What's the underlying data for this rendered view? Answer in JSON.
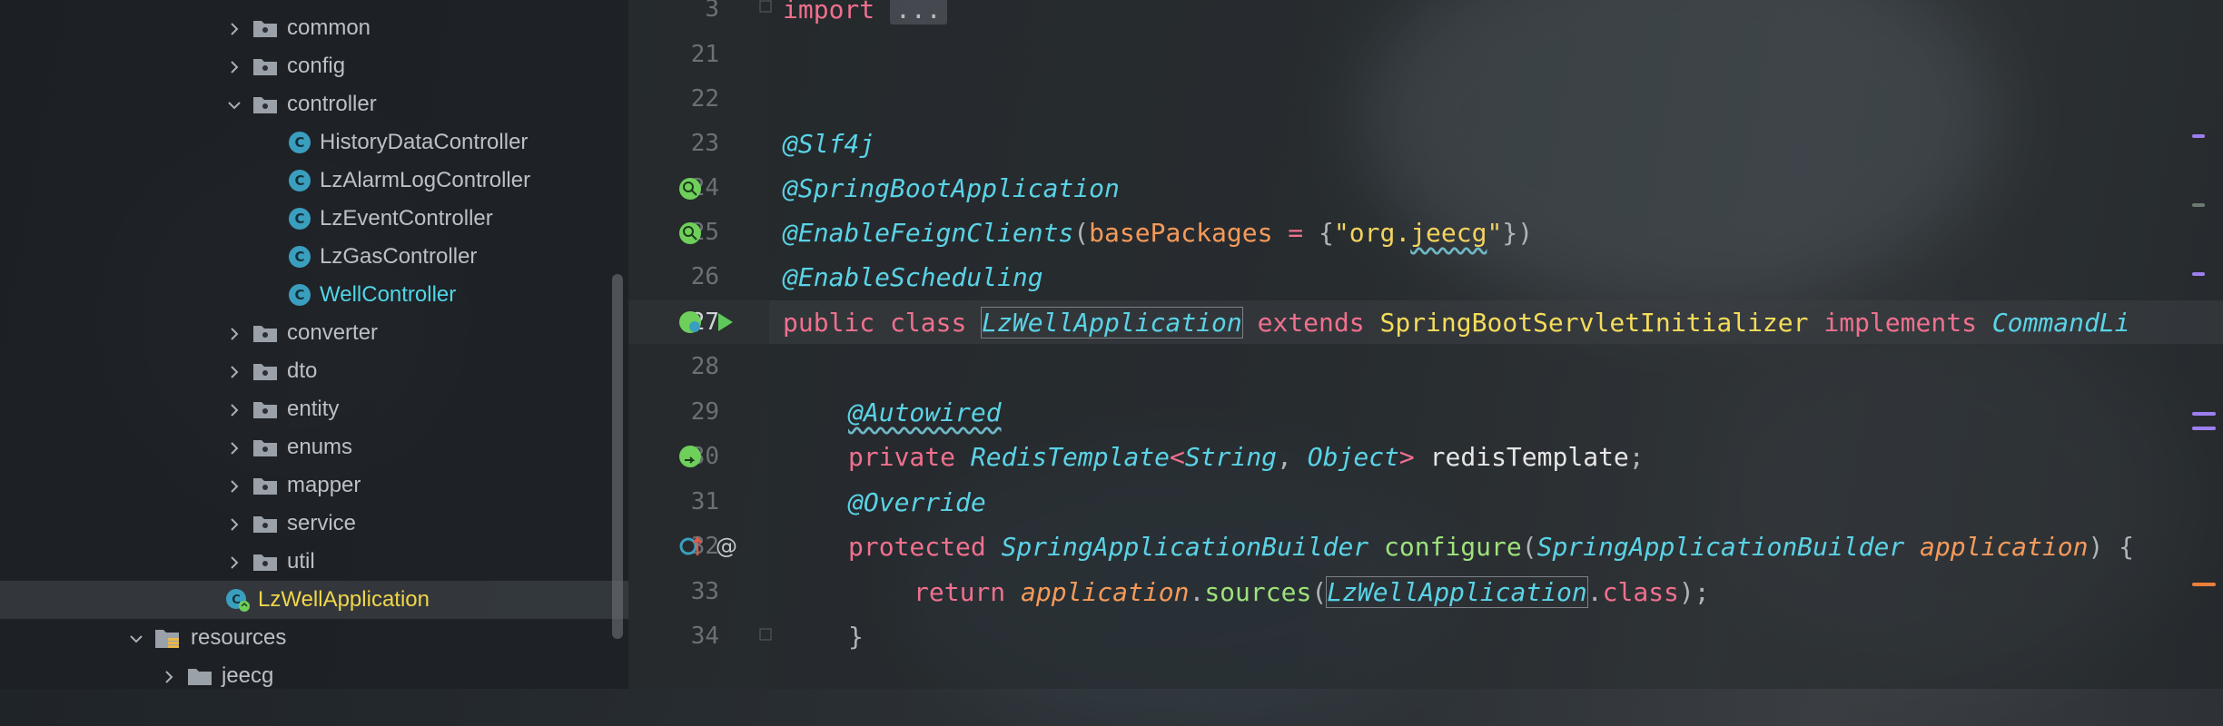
{
  "project_tree": {
    "items": [
      {
        "label": "common",
        "kind": "folder",
        "expanded": false
      },
      {
        "label": "config",
        "kind": "folder",
        "expanded": false
      },
      {
        "label": "controller",
        "kind": "folder",
        "expanded": true
      },
      {
        "label": "HistoryDataController",
        "kind": "class"
      },
      {
        "label": "LzAlarmLogController",
        "kind": "class"
      },
      {
        "label": "LzEventController",
        "kind": "class"
      },
      {
        "label": "LzGasController",
        "kind": "class"
      },
      {
        "label": "WellController",
        "kind": "class"
      },
      {
        "label": "converter",
        "kind": "folder",
        "expanded": false
      },
      {
        "label": "dto",
        "kind": "folder",
        "expanded": false
      },
      {
        "label": "entity",
        "kind": "folder",
        "expanded": false
      },
      {
        "label": "enums",
        "kind": "folder",
        "expanded": false
      },
      {
        "label": "mapper",
        "kind": "folder",
        "expanded": false
      },
      {
        "label": "service",
        "kind": "folder",
        "expanded": false
      },
      {
        "label": "util",
        "kind": "folder",
        "expanded": false
      },
      {
        "label": "LzWellApplication",
        "kind": "app-class"
      },
      {
        "label": "resources",
        "kind": "resources-folder",
        "expanded": true
      },
      {
        "label": "jeecg",
        "kind": "folder",
        "expanded": false
      }
    ]
  },
  "editor": {
    "line_numbers": [
      "3",
      "21",
      "22",
      "23",
      "24",
      "25",
      "26",
      "27",
      "28",
      "29",
      "30",
      "31",
      "32",
      "33",
      "34"
    ],
    "current_line": "27",
    "code": {
      "l3_import": "import",
      "l3_fold": "...",
      "l23": "@Slf4j",
      "l24": "@SpringBootApplication",
      "l25_ann": "@EnableFeignClients",
      "l25_paren_open": "(",
      "l25_param": "basePackages",
      "l25_eq": " = ",
      "l25_brace_open": "{",
      "l25_str_q1": "\"",
      "l25_str_a": "org.",
      "l25_str_b": "jeecg",
      "l25_str_q2": "\"",
      "l25_close": "})",
      "l26": "@EnableScheduling",
      "l27_public": "public",
      "l27_class": "class",
      "l27_name": "LzWellApplication",
      "l27_extends": "extends",
      "l27_parent": "SpringBootServletInitializer",
      "l27_implements": "implements",
      "l27_iface": "CommandLi",
      "l29": "@Autowired",
      "l30_private": "private",
      "l30_type": "RedisTemplate",
      "l30_lt": "<",
      "l30_t1": "String",
      "l30_comma": ", ",
      "l30_t2": "Object",
      "l30_gt": ">",
      "l30_var": "redisTemplate",
      "l30_semi": ";",
      "l31": "@Override",
      "l32_protected": "protected",
      "l32_type": "SpringApplicationBuilder",
      "l32_method": "configure",
      "l32_paren": "(",
      "l32_ptype": "SpringApplicationBuilder",
      "l32_pname": "application",
      "l32_close": ") {",
      "l33_return": "return",
      "l33_obj": "application",
      "l33_dot": ".",
      "l33_method": "sources",
      "l33_paren": "(",
      "l33_arg": "LzWellApplication",
      "l33_dot2": ".",
      "l33_class": "class",
      "l33_end": ");",
      "l34": "}"
    }
  },
  "colors": {
    "keyword": "#f0708e",
    "annotation": "#5ad3e6",
    "string": "#f4d35e",
    "parameter": "#f69a5a",
    "method": "#9ee27b",
    "selected_file": "#f0d64a",
    "active_class": "#4fd6e8"
  }
}
